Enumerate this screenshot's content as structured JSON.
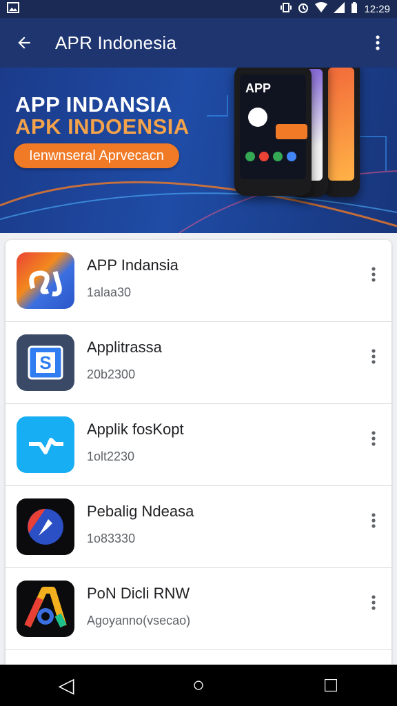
{
  "status_bar": {
    "time": "12:29",
    "icons": [
      "image-icon",
      "vibrate-icon",
      "alarm-icon",
      "wifi-icon",
      "signal-icon",
      "battery-icon"
    ]
  },
  "app_bar": {
    "title": "APR Indonesia",
    "back_icon": "arrow-left-icon",
    "more_icon": "more-vert-icon"
  },
  "banner": {
    "line1": "APP INDANSIA",
    "line2": "APK INDOENSIA",
    "button": "Ienwnseral Aprvecacn",
    "phone_screen_text": "APP",
    "colors": {
      "line1": "#ffffff",
      "line2": "#f4a34a",
      "button": "#f07a26"
    }
  },
  "apps": [
    {
      "name": "APP Indansia",
      "meta": "1alaa30",
      "icon": "app-indansia-icon"
    },
    {
      "name": "Applitrassa",
      "meta": "20b2300",
      "icon": "applitrassa-icon"
    },
    {
      "name": "Applik fosKopt",
      "meta": "1olt2230",
      "icon": "applik-foskopt-icon"
    },
    {
      "name": "Pebalig Ndeasa",
      "meta": "1o83330",
      "icon": "pebalig-ndeasa-icon"
    },
    {
      "name": "PoN Dicli RNW",
      "meta": "Agoyanno(vsecao)",
      "icon": "pon-dicli-rnw-icon"
    }
  ],
  "nav_bar": {
    "back": "◁",
    "home": "○",
    "recents": "□"
  }
}
